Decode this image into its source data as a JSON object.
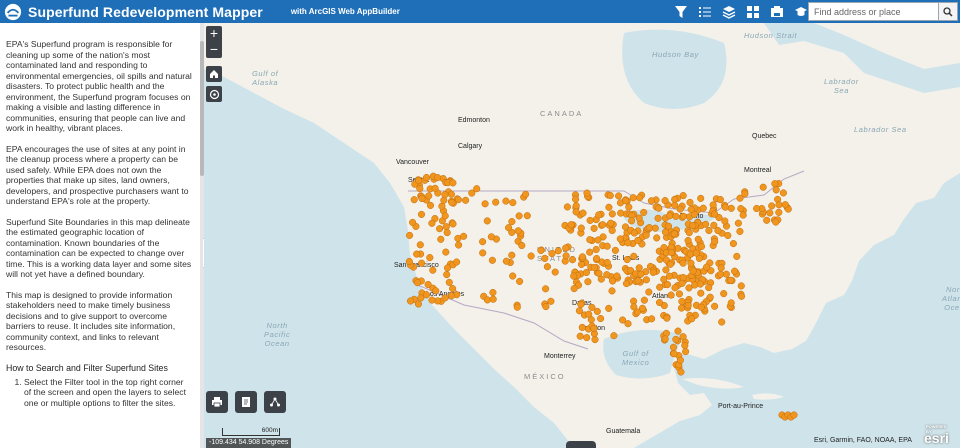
{
  "header": {
    "title": "Superfund Redevelopment Mapper",
    "subtitle": "with ArcGIS Web AppBuilder",
    "tools": [
      "filter-icon",
      "legend-icon",
      "layers-icon",
      "basemap-icon",
      "print-icon",
      "about-icon"
    ]
  },
  "search": {
    "placeholder": "Find address or place"
  },
  "sidebar": {
    "paragraphs": [
      "EPA's Superfund program is responsible for cleaning up some of the nation's most contaminated land and responding to environmental emergencies, oil spills and natural disasters. To protect public health and the environment, the Superfund program focuses on making a visible and lasting difference in communities, ensuring that people can live and work in healthy, vibrant places.",
      "EPA encourages the use of sites at any point in the cleanup process where a property can be used safely. While EPA does not own the properties that make up sites, land owners, developers, and prospective purchasers want to understand EPA's role at the property.",
      "Superfund Site Boundaries in this map delineate the estimated geographic location of contamination. Known boundaries of the contamination can be expected to change over time. This is a working data layer and some sites will not yet have a defined boundary.",
      "This map is designed to provide information stakeholders need to make timely business decisions and to give support to overcome barriers to reuse. It includes site information, community context, and links to relevant resources."
    ],
    "section_heading": "How to Search and Filter Superfund Sites",
    "steps": [
      "Select the Filter tool in the top right corner of the screen and open the layers to select one or multiple options to filter the sites."
    ]
  },
  "map": {
    "water_labels": [
      {
        "id": "gulf-alaska",
        "text": "Gulf of\nAlaska"
      },
      {
        "id": "hudson-bay",
        "text": "Hudson Bay"
      },
      {
        "id": "labrador-sea",
        "text": "Labrador\nSea"
      },
      {
        "id": "north-pacific",
        "text": "North\nPacific\nOcean"
      },
      {
        "id": "gulf-mexico",
        "text": "Gulf of\nMexico"
      },
      {
        "id": "north-atlantic",
        "text": "North\nAtlantic\nOcean"
      }
    ],
    "country_labels": {
      "canada": "CANADA",
      "united_states": "UNITED STATES",
      "mexico": "MÉXICO"
    },
    "city_labels": [
      "Edmonton",
      "Calgary",
      "Vancouver",
      "Seattle",
      "San Francisco",
      "Los Angeles",
      "Dallas",
      "Houston",
      "Monterrey",
      "Toronto",
      "Montreal",
      "St. Louis",
      "Atlanta",
      "Guatemala",
      "Port-au-Prince"
    ],
    "region_labels": [
      "Hudson Strait",
      "Labrador Sea",
      "Quebec"
    ],
    "zoom_in": "+",
    "zoom_out": "−",
    "coordinates": "-109.434 54.908 Degrees",
    "scale_label": "600m",
    "attribution": "Esri, Garmin, FAO, NOAA, EPA",
    "esri_logo": "esri",
    "powered_by": "POWERED BY"
  },
  "colors": {
    "header": "#1f6fb8",
    "site_dot": "#f0951e",
    "land": "#f3f1ea",
    "water": "#cfe3ea",
    "control": "#3d4148"
  }
}
